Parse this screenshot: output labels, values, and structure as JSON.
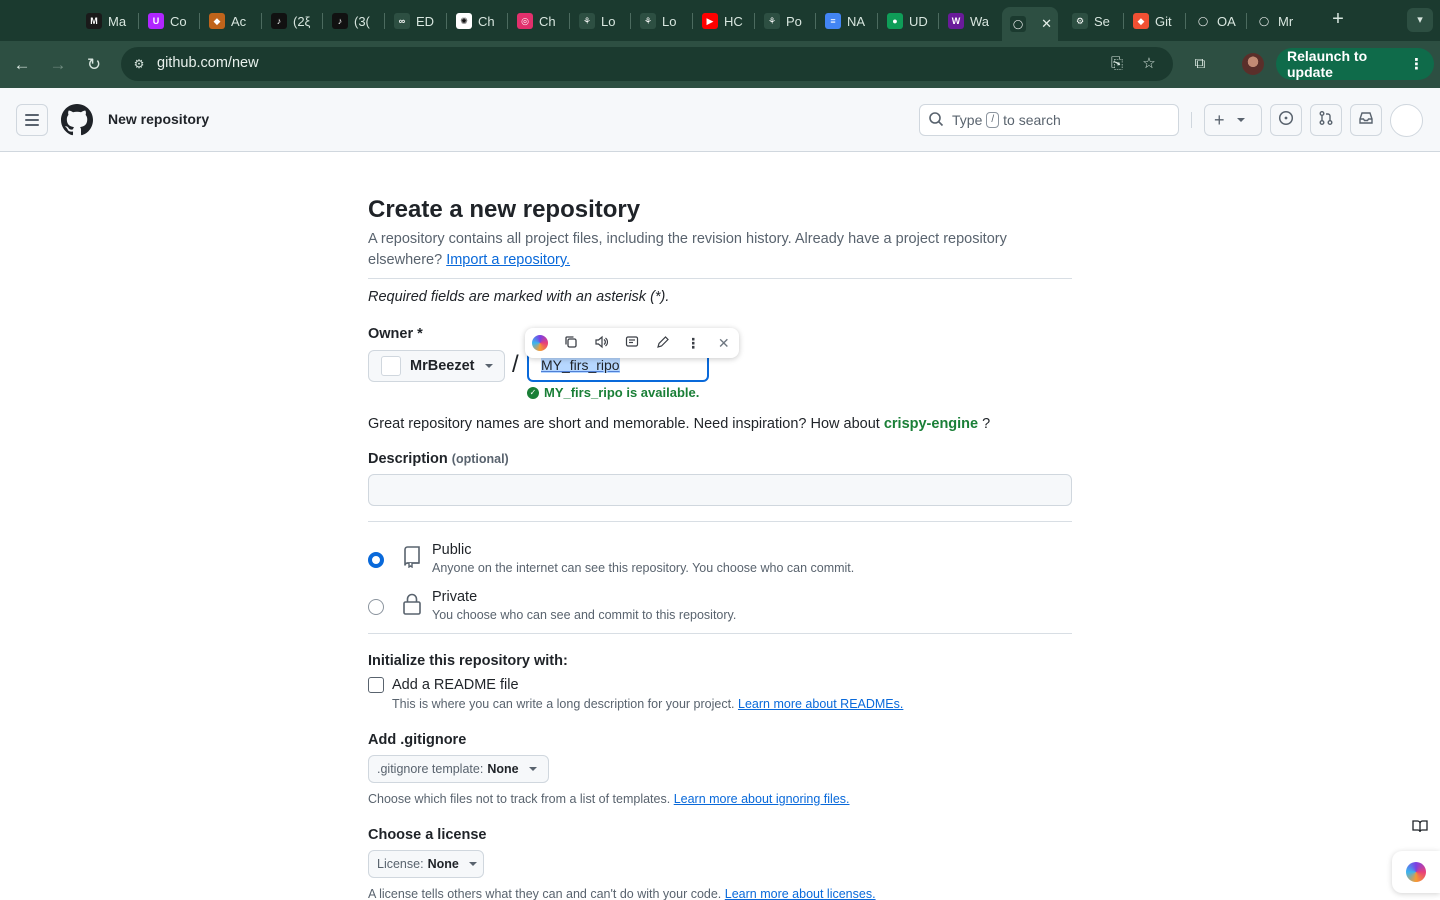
{
  "browser": {
    "tabs": [
      {
        "title": "Ma",
        "icon": "medium-icon",
        "color": "#1a1a1a",
        "glyph": "M"
      },
      {
        "title": "Co",
        "icon": "coursera-like-icon",
        "color": "#b026ff",
        "glyph": "U"
      },
      {
        "title": "Ac",
        "icon": "crypto-icon",
        "color": "#c0641b",
        "glyph": "◆"
      },
      {
        "title": "(2ξ",
        "icon": "tiktok-icon",
        "color": "#111111",
        "glyph": "♪"
      },
      {
        "title": "(3(",
        "icon": "tiktok-icon",
        "color": "#111111",
        "glyph": "♪"
      },
      {
        "title": "ED",
        "icon": "edx-icon",
        "color": "#2d4f42",
        "glyph": "∞"
      },
      {
        "title": "Ch",
        "icon": "chatgpt-icon",
        "color": "#ffffff",
        "glyph": "✺"
      },
      {
        "title": "Ch",
        "icon": "instagram-icon",
        "color": "#e1306c",
        "glyph": "◎"
      },
      {
        "title": "Lo",
        "icon": "lottery-icon",
        "color": "#2d4f42",
        "glyph": "⚘"
      },
      {
        "title": "Lo",
        "icon": "lottery-icon",
        "color": "#2d4f42",
        "glyph": "⚘"
      },
      {
        "title": "HC",
        "icon": "youtube-icon",
        "color": "#ff0000",
        "glyph": "▶"
      },
      {
        "title": "Po",
        "icon": "lottery-icon",
        "color": "#2d4f42",
        "glyph": "⚘"
      },
      {
        "title": "NA",
        "icon": "google-docs-icon",
        "color": "#4285f4",
        "glyph": "≡"
      },
      {
        "title": "UD",
        "icon": "udemy-icon",
        "color": "#0f9d58",
        "glyph": "●"
      },
      {
        "title": "Wa",
        "icon": "wn-icon",
        "color": "#6a1b9a",
        "glyph": "W"
      },
      {
        "title": "",
        "icon": "github-icon",
        "color": "#1b3a2f",
        "glyph": "◯",
        "active": true
      },
      {
        "title": "Se",
        "icon": "settings-icon",
        "color": "#2d4f42",
        "glyph": "⚙"
      },
      {
        "title": "Git",
        "icon": "git-icon",
        "color": "#f05033",
        "glyph": "◆"
      },
      {
        "title": "OA",
        "icon": "github-icon",
        "color": "#1b3a2f",
        "glyph": "◯"
      },
      {
        "title": "Mr",
        "icon": "github-icon",
        "color": "#1b3a2f",
        "glyph": "◯"
      }
    ],
    "url": "github.com/new",
    "relaunch_label": "Relaunch to update"
  },
  "header": {
    "title": "New repository",
    "search_text_before": "Type",
    "search_key": "/",
    "search_text_after": "to search"
  },
  "form": {
    "title": "Create a new repository",
    "lead_text": "A repository contains all project files, including the revision history. Already have a project repository elsewhere?",
    "import_link": "Import a repository.",
    "required_note": "Required fields are marked with an asterisk (*).",
    "owner_label": "Owner *",
    "owner_value": "MrBeezet",
    "slash": "/",
    "repo_name_value": "MY_firs_ripo",
    "availability": "MY_firs_ripo is available.",
    "inspiration_before": "Great repository names are short and memorable. Need inspiration? How about",
    "inspiration_suggestion": "crispy-engine",
    "inspiration_after": "?",
    "description_label": "Description",
    "description_optional": "(optional)",
    "description_value": "",
    "visibility": [
      {
        "title": "Public",
        "subtitle": "Anyone on the internet can see this repository. You choose who can commit.",
        "selected": true
      },
      {
        "title": "Private",
        "subtitle": "You choose who can see and commit to this repository.",
        "selected": false
      }
    ],
    "init_label": "Initialize this repository with:",
    "readme_label": "Add a README file",
    "readme_checked": false,
    "readme_sub": "This is where you can write a long description for your project.",
    "readme_link": "Learn more about READMEs.",
    "gitignore_label": "Add .gitignore",
    "gitignore_dd_prefix": ".gitignore template:",
    "gitignore_dd_value": "None",
    "gitignore_hint": "Choose which files not to track from a list of templates.",
    "gitignore_link": "Learn more about ignoring files.",
    "license_label": "Choose a license",
    "license_dd_prefix": "License:",
    "license_dd_value": "None",
    "license_hint": "A license tells others what they can and can't do with your code.",
    "license_link": "Learn more about licenses."
  },
  "text_toolbar": {
    "buttons": [
      "ai-assistant-icon",
      "copy-icon",
      "read-aloud-icon",
      "summarize-icon",
      "edit-icon",
      "more-icon",
      "close-icon"
    ]
  },
  "colors": {
    "accent_blue": "#0969da",
    "success_green": "#1a7f37",
    "chrome_dark": "#1b3a2f",
    "chrome_mid": "#2d4f42",
    "relaunch_green": "#0f6b4a"
  }
}
